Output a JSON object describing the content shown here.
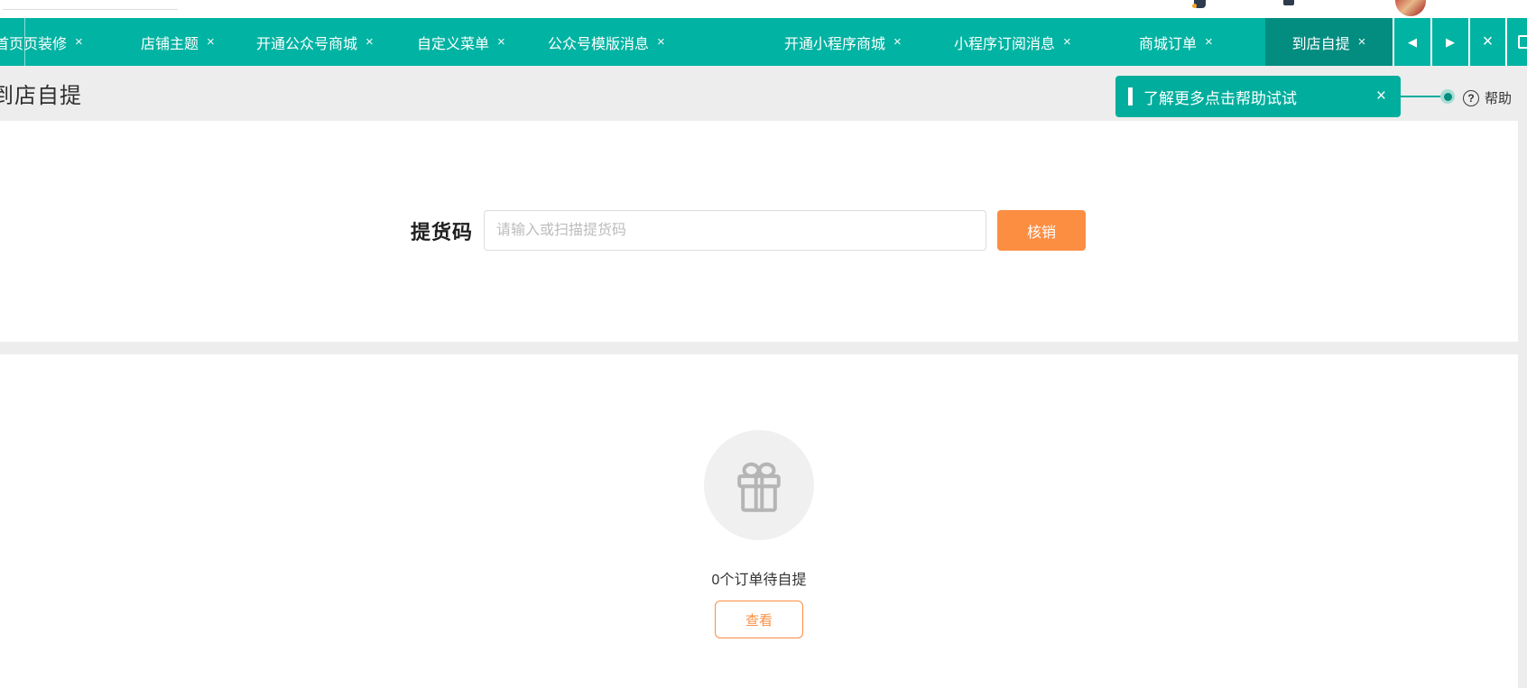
{
  "topbar": {
    "icons": [
      "pen-icon-fragment",
      "screen-icon-fragment",
      "user-avatar"
    ]
  },
  "tabbar": {
    "tabs": [
      {
        "label": "首页",
        "closable": false,
        "active": false
      },
      {
        "label": "页装修",
        "closable": true,
        "active": false
      },
      {
        "label": "店铺主题",
        "closable": true,
        "active": false
      },
      {
        "label": "开通公众号商城",
        "closable": true,
        "active": false
      },
      {
        "label": "自定义菜单",
        "closable": true,
        "active": false
      },
      {
        "label": "公众号模版消息",
        "closable": true,
        "active": false
      },
      {
        "label": "开通小程序商城",
        "closable": true,
        "active": false
      },
      {
        "label": "小程序订阅消息",
        "closable": true,
        "active": false
      },
      {
        "label": "商城订单",
        "closable": true,
        "active": false
      },
      {
        "label": "到店自提",
        "closable": true,
        "active": true
      }
    ],
    "close_glyph": "×",
    "controls": {
      "prev": "◀",
      "next": "▶",
      "close_all": "×"
    }
  },
  "header": {
    "title": "到店自提"
  },
  "help_banner": {
    "text": "了解更多点击帮助试试",
    "close": "×"
  },
  "help": {
    "icon_glyph": "?",
    "label": "帮助"
  },
  "pickup": {
    "label": "提货码",
    "placeholder": "请输入或扫描提货码",
    "verify_button": "核销"
  },
  "empty_state": {
    "message": "0个订单待自提",
    "view_button": "查看"
  },
  "colors": {
    "tabbar": "#01b3a2",
    "tab_active": "#028d80",
    "banner": "#01ae9d",
    "accent_orange": "#fc8e42",
    "page_bg": "#ededed"
  }
}
